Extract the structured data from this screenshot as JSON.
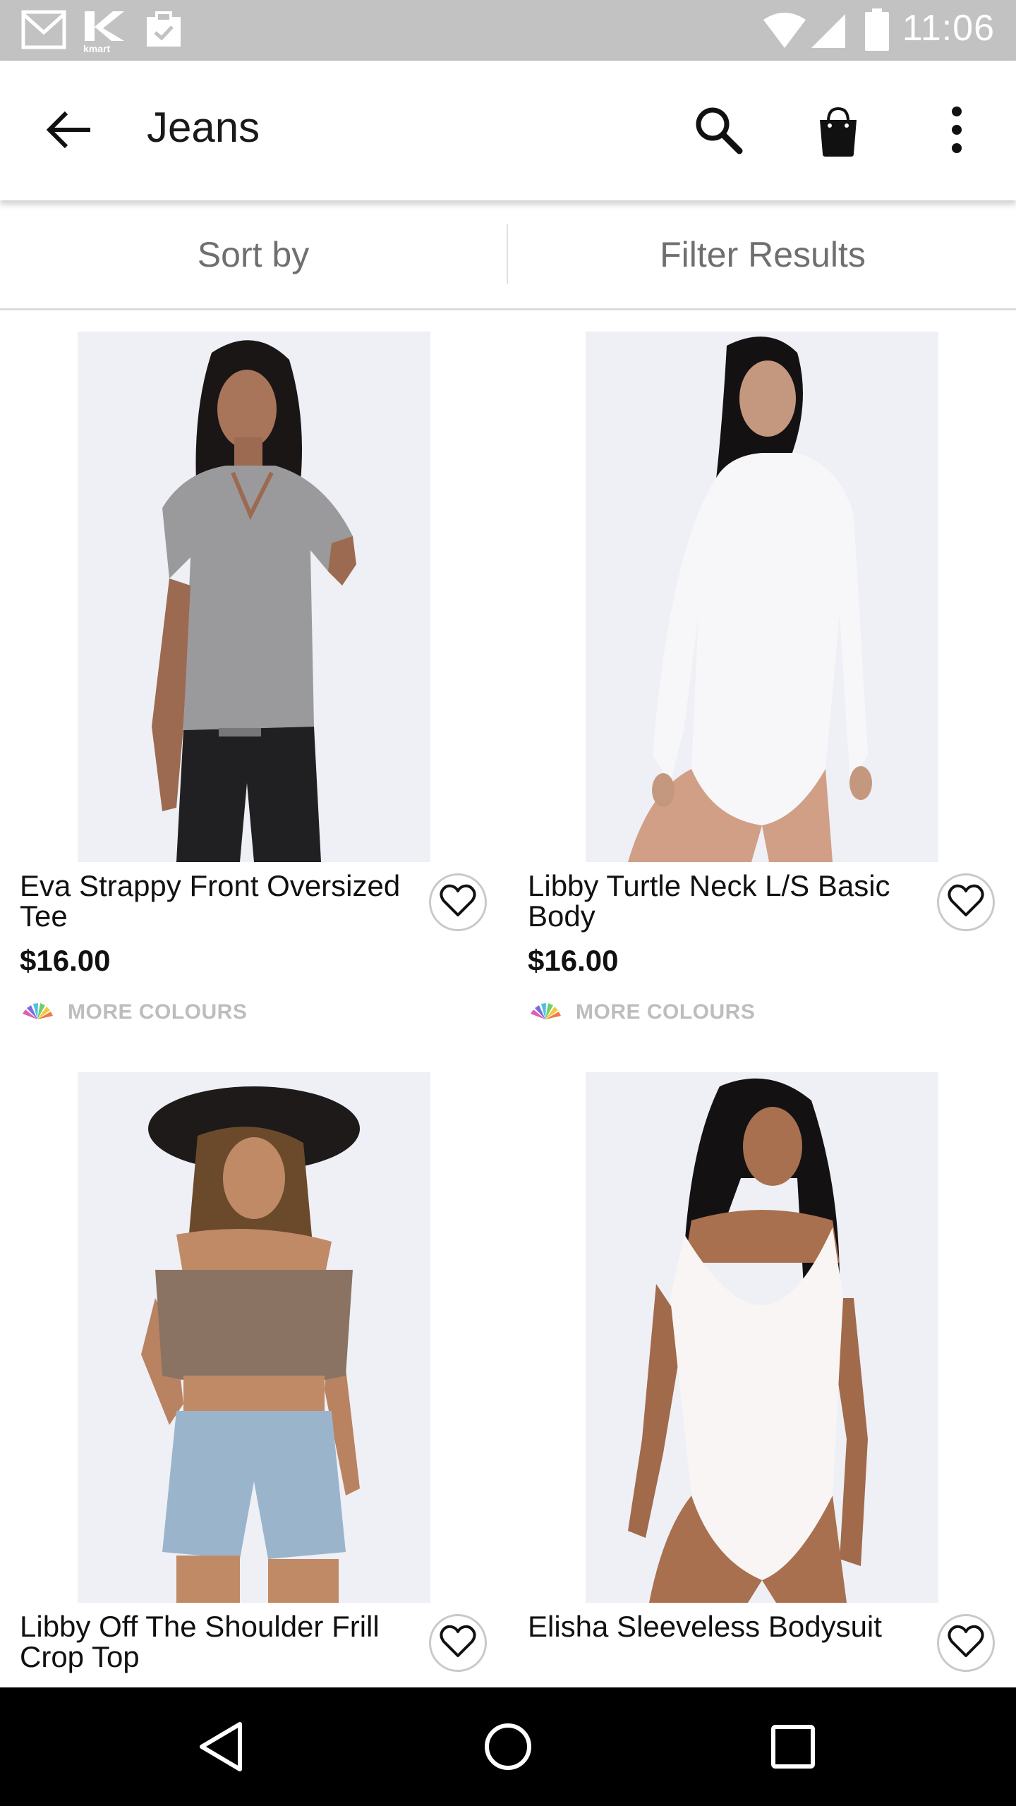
{
  "status_bar": {
    "time": "11:06",
    "icons": [
      "gmail-icon",
      "kmart-icon",
      "clipboard-icon",
      "wifi-icon",
      "signal-icon",
      "battery-icon"
    ],
    "kmart_label": "kmart"
  },
  "app_bar": {
    "title": "Jeans",
    "icons": [
      "back-arrow-icon",
      "search-icon",
      "shopping-bag-icon",
      "more-vert-icon"
    ]
  },
  "sort_bar": {
    "sort_label": "Sort by",
    "filter_label": "Filter Results"
  },
  "products": [
    {
      "name": "Eva Strappy Front Oversized Tee",
      "price": "$16.00",
      "more_colours": "MORE COLOURS",
      "favorite": false
    },
    {
      "name": "Libby Turtle Neck L/S Basic Body",
      "price": "$16.00",
      "more_colours": "MORE COLOURS",
      "favorite": false
    },
    {
      "name": "Libby Off The Shoulder Frill Crop Top",
      "price": "",
      "more_colours": "",
      "favorite": false
    },
    {
      "name": "Elisha Sleeveless Bodysuit",
      "price": "",
      "more_colours": "",
      "favorite": false
    }
  ],
  "nav_bar": {
    "icons": [
      "back-nav-icon",
      "home-nav-icon",
      "recents-nav-icon"
    ]
  },
  "colors": {
    "status_bar_bg": "#c2c2c2",
    "app_bar_bg": "#ffffff",
    "nav_bar_bg": "#000000",
    "secondary_text": "#6f6f6f",
    "more_colours_text": "#bdbdbd"
  }
}
